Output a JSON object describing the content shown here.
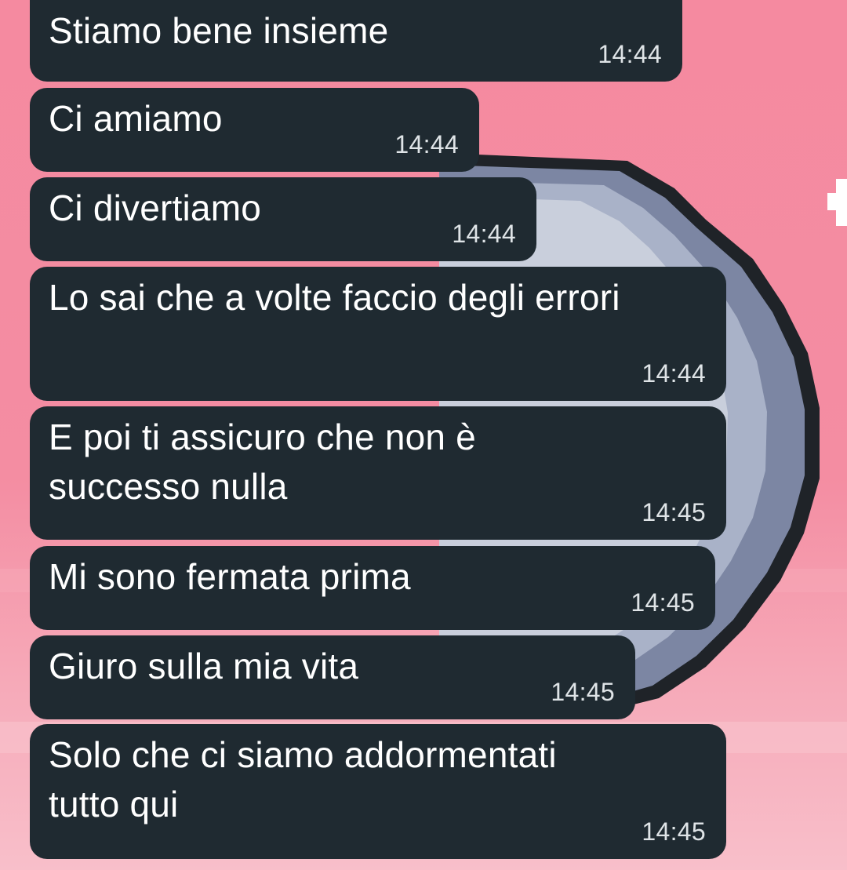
{
  "messages": [
    {
      "text": "Stiamo bene insieme",
      "time": "14:44"
    },
    {
      "text": "Ci amiamo",
      "time": "14:44"
    },
    {
      "text": "Ci divertiamo",
      "time": "14:44"
    },
    {
      "text": "Lo sai che a volte faccio degli errori",
      "time": "14:44"
    },
    {
      "text": "E poi ti assicuro che non è\nsuccesso nulla",
      "time": "14:45"
    },
    {
      "text": "Mi sono fermata prima",
      "time": "14:45"
    },
    {
      "text": "Giuro sulla mia vita",
      "time": "14:45"
    },
    {
      "text": "Solo che ci siamo addormentati\ntutto qui",
      "time": "14:45"
    }
  ],
  "theme": {
    "bubble_color": "#1f2a31",
    "wallpaper_color": "#f58aa0",
    "text_color": "#ffffff",
    "time_color": "#dfe4e7"
  }
}
